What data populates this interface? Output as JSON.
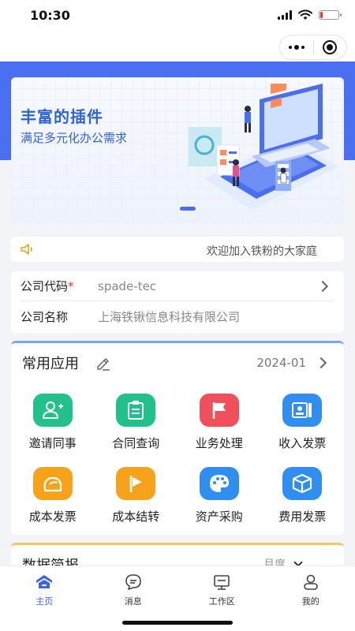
{
  "status_bar": {
    "time": "10:30",
    "battery_level": 0.15
  },
  "banner": {
    "title": "丰富的插件",
    "subtitle": "满足多元化办公需求",
    "illustration_icon": "office-computer-illustration"
  },
  "notice": {
    "icon": "speaker-icon",
    "text": "欢迎加入铁粉的大家庭"
  },
  "company": {
    "code_label": "公司代码",
    "required_mark": "*",
    "code_value": "spade-tec",
    "name_label": "公司名称",
    "name_value": "上海铁锹信息科技有限公司"
  },
  "apps": {
    "title": "常用应用",
    "date": "2024-01",
    "items": [
      {
        "label": "邀请同事",
        "icon": "invite-user-icon",
        "color": "#22c08a"
      },
      {
        "label": "合同查询",
        "icon": "clipboard-icon",
        "color": "#22c08a"
      },
      {
        "label": "业务处理",
        "icon": "flag-icon",
        "color": "#f04f5b"
      },
      {
        "label": "收入发票",
        "icon": "invoice-icon",
        "color": "#2f8ef0"
      },
      {
        "label": "成本发票",
        "icon": "cost-invoice-icon",
        "color": "#f7a21b"
      },
      {
        "label": "成本结转",
        "icon": "play-flag-icon",
        "color": "#f7a21b"
      },
      {
        "label": "资产采购",
        "icon": "palette-icon",
        "color": "#2f8ef0"
      },
      {
        "label": "费用发票",
        "icon": "box-icon",
        "color": "#2f8ef0"
      }
    ]
  },
  "data_section": {
    "title": "数据简报",
    "filter": "月度"
  },
  "tabbar": {
    "items": [
      {
        "label": "主页",
        "icon": "home-icon",
        "active": true
      },
      {
        "label": "消息",
        "icon": "message-icon",
        "active": false
      },
      {
        "label": "工作区",
        "icon": "workspace-icon",
        "active": false
      },
      {
        "label": "我的",
        "icon": "profile-icon",
        "active": false
      }
    ]
  },
  "colors": {
    "brand_blue": "#4a6ff0",
    "active_tab": "#3c63e6",
    "required": "#e53935"
  }
}
